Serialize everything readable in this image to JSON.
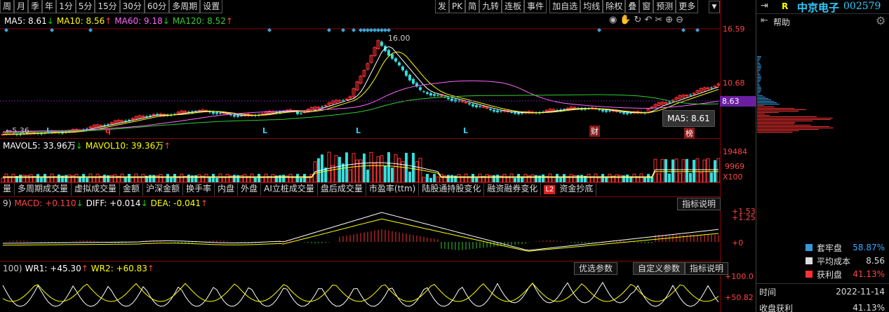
{
  "top_tabs_left": [
    "周",
    "月",
    "季",
    "年",
    "1分",
    "5分",
    "15分",
    "30分",
    "60分",
    "多周期",
    "设置"
  ],
  "top_tabs_right": [
    "发",
    "PK",
    "简",
    "九转",
    "连板",
    "事件",
    "加自选",
    "均线",
    "除权",
    "叠",
    "窗",
    "预测",
    "更多"
  ],
  "ma_line": [
    {
      "text": "MA5: 8.61",
      "color": "#ffffff"
    },
    {
      "text": "↓",
      "color": "#00dd00"
    },
    {
      "text": "MA10: 8.56",
      "color": "#ffff00"
    },
    {
      "text": "↑",
      "color": "#ff4444"
    },
    {
      "text": "MA60: 9.18",
      "color": "#ff66ff"
    },
    {
      "text": "↓",
      "color": "#00dd00"
    },
    {
      "text": "MA120: 8.52",
      "color": "#33cc33"
    },
    {
      "text": "↑",
      "color": "#ff4444"
    }
  ],
  "price_axis": {
    "high": "16.59",
    "mid": "10.68",
    "current": "8.63"
  },
  "chart_labels": {
    "peak": "16.00",
    "low": "5.36",
    "low_prefix": "←",
    "cai": "财",
    "bang": "榜",
    "q": "q",
    "L": "L"
  },
  "tooltip": "MA5: 8.61",
  "vol_line": [
    {
      "text": "MAVOL5: 33.96万",
      "color": "#ffffff"
    },
    {
      "text": "↓",
      "color": "#00dd00"
    },
    {
      "text": "MAVOL10: 39.36万",
      "color": "#ffff00"
    },
    {
      "text": "↑",
      "color": "#ff4444"
    }
  ],
  "vol_axis": {
    "high": "19484",
    "mid": "9969",
    "unit": "X100"
  },
  "sub_tabs": [
    "量",
    "多周期成交量",
    "虚拟成交量",
    "金额",
    "沪深金额",
    "换手率",
    "内盘",
    "外盘",
    "AI立桩成交量",
    "盘后成交量",
    "市盈率(ttm)",
    "陆股通持股变化",
    "融资融券变化",
    "资金抄底"
  ],
  "sub_tab_l2": "L2",
  "macd_line": [
    {
      "text": "9)",
      "color": "#cccccc"
    },
    {
      "text": "MACD: +0.110",
      "color": "#ff4444"
    },
    {
      "text": "↓",
      "color": "#00dd00"
    },
    {
      "text": "DIFF: +0.014",
      "color": "#ffffff"
    },
    {
      "text": "↓",
      "color": "#00dd00"
    },
    {
      "text": "DEA: -0.041",
      "color": "#ffff00"
    },
    {
      "text": "↑",
      "color": "#ff4444"
    }
  ],
  "macd_axis": {
    "a": "+1.53",
    "b": "+1.25",
    "zero": "+0"
  },
  "indicator_help": "指标说明",
  "wr_line": [
    {
      "text": "100)",
      "color": "#cccccc"
    },
    {
      "text": "WR1: +45.30",
      "color": "#ffffff"
    },
    {
      "text": "↑",
      "color": "#ff4444"
    },
    {
      "text": "WR2: +60.83",
      "color": "#ffff00"
    },
    {
      "text": "↑",
      "color": "#ff4444"
    }
  ],
  "wr_axis": {
    "top": "+100.0",
    "mid": "+50.82"
  },
  "wr_buttons": [
    "优选参数",
    "自定义参数",
    "指标说明"
  ],
  "right_panel": {
    "r_badge": "R",
    "stock_name": "中京电子",
    "stock_code": "002579",
    "help": "帮助",
    "legend": [
      {
        "label": "套牢盘",
        "value": "58.87%",
        "color": "#3399dd"
      },
      {
        "label": "平均成本",
        "value": "8.56",
        "color": "#dddddd"
      },
      {
        "label": "获利盘",
        "value": "41.13%",
        "color": "#ff3333"
      }
    ],
    "time_label": "时间",
    "time_value": "2022-11-14",
    "profit_label": "收盘获利",
    "profit_value": "41.13%"
  },
  "colors": {
    "up": "#ff3333",
    "down": "#33dddd",
    "grid": "#8b0000",
    "accent": "#00ffff"
  }
}
